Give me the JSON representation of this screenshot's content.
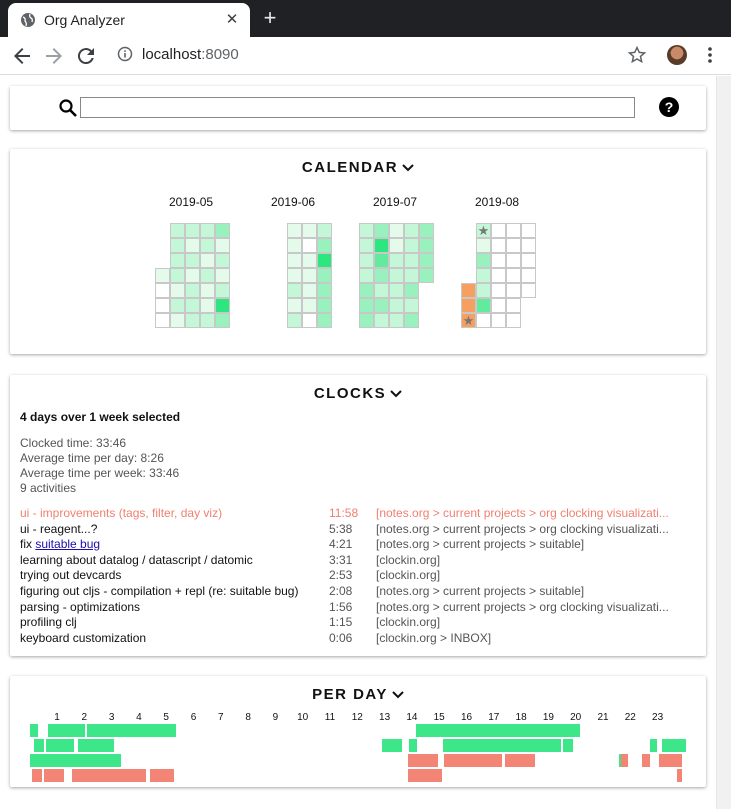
{
  "browser": {
    "tab_title": "Org Analyzer",
    "url_host": "localhost",
    "url_port": ":8090"
  },
  "search": {
    "value": "",
    "placeholder": ""
  },
  "calendar": {
    "title": "CALENDAR",
    "months": [
      "2019-05",
      "2019-06",
      "2019-07",
      "2019-08"
    ]
  },
  "clocks": {
    "title": "CLOCKS",
    "summary": "4 days over 1 week selected",
    "stats": [
      "Clocked time: 33:46",
      "Average time per day: 8:26",
      "Average time per week: 33:46",
      "9 activities"
    ],
    "activities": [
      {
        "name": "ui - improvements (tags, filter, day viz)",
        "time": "11:58",
        "path": "[notes.org > current projects > org clocking visualizati...",
        "highlight": true
      },
      {
        "name": "ui - reagent...?",
        "time": "5:38",
        "path": "[notes.org > current projects > org clocking visualizati..."
      },
      {
        "name_prefix": "fix ",
        "link": "suitable bug",
        "time": "4:21",
        "path": "[notes.org > current projects > suitable]"
      },
      {
        "name": "learning about datalog / datascript / datomic",
        "time": "3:31",
        "path": "[clockin.org]"
      },
      {
        "name": "trying out devcards",
        "time": "2:53",
        "path": "[clockin.org]"
      },
      {
        "name": "figuring out cljs - compilation + repl (re: suitable bug)",
        "time": "2:08",
        "path": "[notes.org > current projects > suitable]"
      },
      {
        "name": "parsing - optimizations",
        "time": "1:56",
        "path": "[notes.org > current projects > org clocking visualizati..."
      },
      {
        "name": "profiling clj",
        "time": "1:15",
        "path": "[clockin.org]"
      },
      {
        "name": "keyboard customization",
        "time": "0:06",
        "path": "[clockin.org > INBOX]"
      }
    ]
  },
  "perday": {
    "title": "PER DAY",
    "hours": [
      "1",
      "2",
      "3",
      "4",
      "5",
      "6",
      "7",
      "8",
      "9",
      "10",
      "11",
      "12",
      "13",
      "14",
      "15",
      "16",
      "17",
      "18",
      "19",
      "20",
      "21",
      "22",
      "23"
    ]
  },
  "colors": {
    "activity_green": "#3ee68a",
    "activity_red": "#f28575",
    "highlight": "#f08070",
    "today_orange": "#f5a060"
  },
  "icons": [
    "globe-icon",
    "close-icon",
    "plus-icon",
    "back-arrow-icon",
    "forward-arrow-icon",
    "reload-icon",
    "info-icon",
    "star-icon",
    "menu-icon",
    "search-icon",
    "help-icon",
    "chevron-down-icon"
  ]
}
